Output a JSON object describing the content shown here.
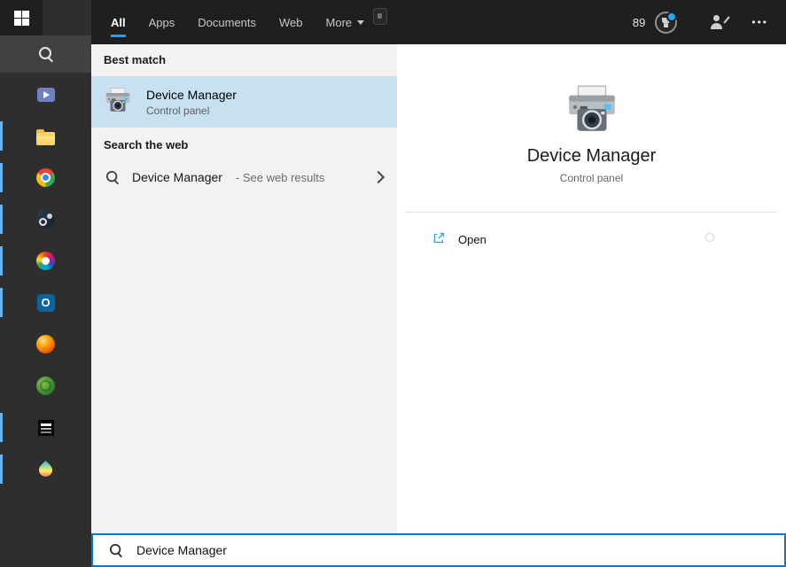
{
  "colors": {
    "accent": "#0078d7",
    "highlight": "#c7e0f2",
    "taskbar": "#2e2e2e",
    "topbar": "#1f1f1f"
  },
  "icons": {
    "outlook_glyph": "O",
    "ellipsis_glyph": "•••"
  },
  "taskbar": {
    "apps": [
      {
        "name": "movies-tv",
        "running": false
      },
      {
        "name": "file-explorer",
        "running": true
      },
      {
        "name": "chrome",
        "running": true
      },
      {
        "name": "steam",
        "running": true
      },
      {
        "name": "media-app",
        "running": true
      },
      {
        "name": "outlook",
        "running": true
      },
      {
        "name": "browser",
        "running": false
      },
      {
        "name": "green-app",
        "running": false
      },
      {
        "name": "ddu",
        "running": true
      },
      {
        "name": "rgb-app",
        "running": true
      }
    ]
  },
  "topbar": {
    "tabs": [
      {
        "label": "All",
        "active": true
      },
      {
        "label": "Apps"
      },
      {
        "label": "Documents"
      },
      {
        "label": "Web"
      },
      {
        "label": "More",
        "dropdown": true
      }
    ],
    "rewards_points": "89"
  },
  "results": {
    "best_match_label": "Best match",
    "best_match": {
      "title": "Device Manager",
      "subtitle": "Control panel"
    },
    "web_section_label": "Search the web",
    "web_result": {
      "query": "Device Manager",
      "hint": "- See web results"
    }
  },
  "preview": {
    "title": "Device Manager",
    "subtitle": "Control panel",
    "open_label": "Open"
  },
  "searchbox": {
    "value": "Device Manager"
  }
}
